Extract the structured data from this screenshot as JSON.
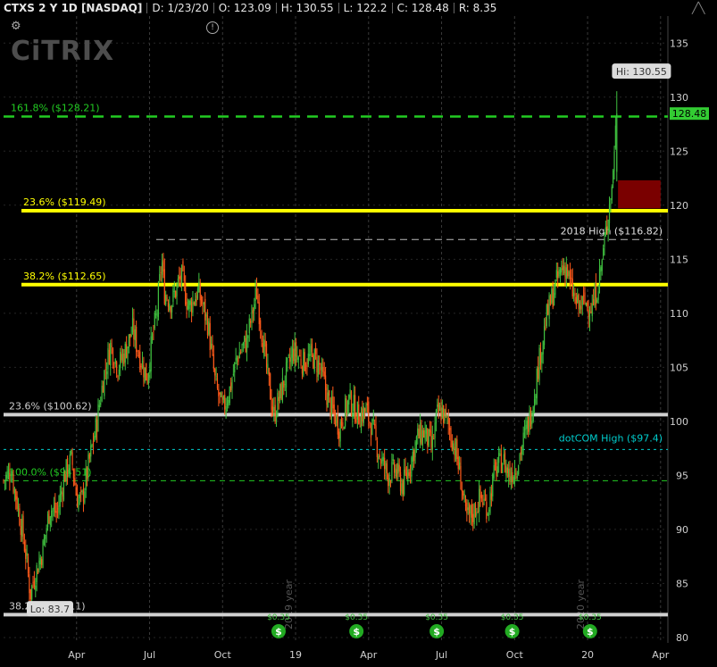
{
  "header": {
    "symbol": "CTXS 2 Y 1D [NASDAQ]",
    "date": "D: 1/23/20",
    "open": "O: 123.09",
    "high": "H: 130.55",
    "low": "L: 122.2",
    "close": "C: 128.48",
    "range": "R: 8.35"
  },
  "logo_text": "CiTRIX",
  "colors": {
    "background": "#000000",
    "up": "#3fbf3f",
    "down": "#ff5a1a",
    "fib_yellow": "#ffff00",
    "fib_green": "#22cc22",
    "white_line": "#d0d0d0",
    "dotcom": "#00cccc",
    "last_price": "#33cc33",
    "zone": "#7a0000"
  },
  "chart_data": {
    "type": "candlestick",
    "y_ticks": [
      80,
      85,
      90,
      95,
      100,
      105,
      110,
      115,
      120,
      125,
      130,
      135
    ],
    "ylim": [
      79.5,
      137.5
    ],
    "x_ticks": [
      "Apr",
      "Jul",
      "Oct",
      "19",
      "Apr",
      "Jul",
      "Oct",
      "20",
      "Apr"
    ],
    "x_tick_months": [
      3,
      6,
      9,
      12,
      15,
      18,
      21,
      24,
      27
    ],
    "xlim_months": [
      0,
      27.3
    ],
    "year_watermarks": [
      "2019 year",
      "2020 year"
    ],
    "hi_label": "Hi: 130.55",
    "lo_label": "Lo: 83.7",
    "last_price_label": "128.48",
    "last_price": 128.48,
    "levels": [
      {
        "label": "161.8%  ($128.21)",
        "value": 128.21,
        "style": "green-dash-thick"
      },
      {
        "label": "23.6%  ($119.49)",
        "value": 119.49,
        "style": "yellow"
      },
      {
        "label": "2018 High  ($116.82)",
        "value": 116.82,
        "style": "white-dash"
      },
      {
        "label": "38.2%  ($112.65)",
        "value": 112.65,
        "style": "yellow"
      },
      {
        "label": "23.6% ($100.62)",
        "value": 100.62,
        "style": "white"
      },
      {
        "label": "dotCOM High  ($97.4)",
        "value": 97.4,
        "style": "cyan-dash"
      },
      {
        "label": "100.0% ($94.51)",
        "value": 94.51,
        "style": "green-dash-thin"
      },
      {
        "label": "38.2% ($82.11)",
        "value": 82.11,
        "style": "white"
      }
    ],
    "price_path": [
      [
        0.0,
        94.5
      ],
      [
        0.3,
        95.5
      ],
      [
        0.6,
        92.0
      ],
      [
        0.9,
        88.0
      ],
      [
        1.1,
        84.0
      ],
      [
        1.25,
        85.5
      ],
      [
        1.6,
        88.0
      ],
      [
        1.9,
        92.0
      ],
      [
        2.2,
        91.5
      ],
      [
        2.5,
        95.0
      ],
      [
        2.8,
        96.5
      ],
      [
        3.0,
        93.0
      ],
      [
        3.2,
        92.5
      ],
      [
        3.5,
        96.0
      ],
      [
        3.8,
        99.5
      ],
      [
        4.1,
        104.0
      ],
      [
        4.4,
        107.0
      ],
      [
        4.7,
        105.0
      ],
      [
        5.0,
        106.5
      ],
      [
        5.3,
        108.5
      ],
      [
        5.6,
        106.0
      ],
      [
        5.9,
        104.0
      ],
      [
        6.1,
        107.5
      ],
      [
        6.3,
        110.0
      ],
      [
        6.5,
        115.0
      ],
      [
        6.6,
        112.0
      ],
      [
        6.9,
        111.0
      ],
      [
        7.3,
        113.5
      ],
      [
        7.6,
        110.5
      ],
      [
        8.0,
        112.0
      ],
      [
        8.4,
        109.0
      ],
      [
        8.7,
        103.5
      ],
      [
        9.0,
        101.0
      ],
      [
        9.3,
        103.0
      ],
      [
        9.6,
        106.0
      ],
      [
        10.0,
        107.5
      ],
      [
        10.4,
        112.0
      ],
      [
        10.8,
        105.0
      ],
      [
        11.1,
        100.5
      ],
      [
        11.5,
        103.5
      ],
      [
        11.9,
        106.5
      ],
      [
        12.3,
        105.5
      ],
      [
        12.7,
        106.0
      ],
      [
        13.0,
        105.0
      ],
      [
        13.4,
        101.5
      ],
      [
        13.8,
        99.5
      ],
      [
        14.2,
        102.0
      ],
      [
        14.6,
        100.5
      ],
      [
        14.9,
        101.0
      ],
      [
        15.2,
        99.0
      ],
      [
        15.5,
        96.5
      ],
      [
        15.8,
        95.0
      ],
      [
        16.1,
        95.5
      ],
      [
        16.4,
        94.0
      ],
      [
        16.7,
        96.0
      ],
      [
        17.0,
        98.5
      ],
      [
        17.3,
        99.0
      ],
      [
        17.6,
        97.5
      ],
      [
        17.8,
        100.5
      ],
      [
        18.0,
        101.0
      ],
      [
        18.3,
        99.5
      ],
      [
        18.6,
        97.0
      ],
      [
        18.8,
        94.5
      ],
      [
        19.0,
        91.0
      ],
      [
        19.3,
        91.5
      ],
      [
        19.6,
        93.0
      ],
      [
        19.9,
        92.0
      ],
      [
        20.2,
        95.5
      ],
      [
        20.5,
        96.5
      ],
      [
        20.8,
        95.0
      ],
      [
        21.1,
        96.0
      ],
      [
        21.4,
        98.5
      ],
      [
        21.7,
        101.0
      ],
      [
        22.0,
        105.5
      ],
      [
        22.3,
        109.5
      ],
      [
        22.6,
        112.0
      ],
      [
        22.9,
        114.0
      ],
      [
        23.1,
        114.5
      ],
      [
        23.3,
        112.5
      ],
      [
        23.6,
        110.5
      ],
      [
        23.9,
        111.0
      ],
      [
        24.2,
        110.5
      ],
      [
        24.5,
        113.5
      ],
      [
        24.7,
        116.5
      ],
      [
        24.85,
        119.5
      ],
      [
        25.0,
        121.5
      ],
      [
        25.1,
        125.5
      ],
      [
        25.2,
        128.48
      ]
    ],
    "zone": {
      "from_month": 25.25,
      "to_month": 27.0,
      "from_value": 119.7,
      "to_value": 122.3
    },
    "events_y": [
      "$0.35",
      "$0.35",
      "$0.35",
      "$0.35",
      "$0.35"
    ],
    "event_months_y": [
      11.3,
      14.5,
      17.8,
      20.9,
      24.1
    ]
  }
}
